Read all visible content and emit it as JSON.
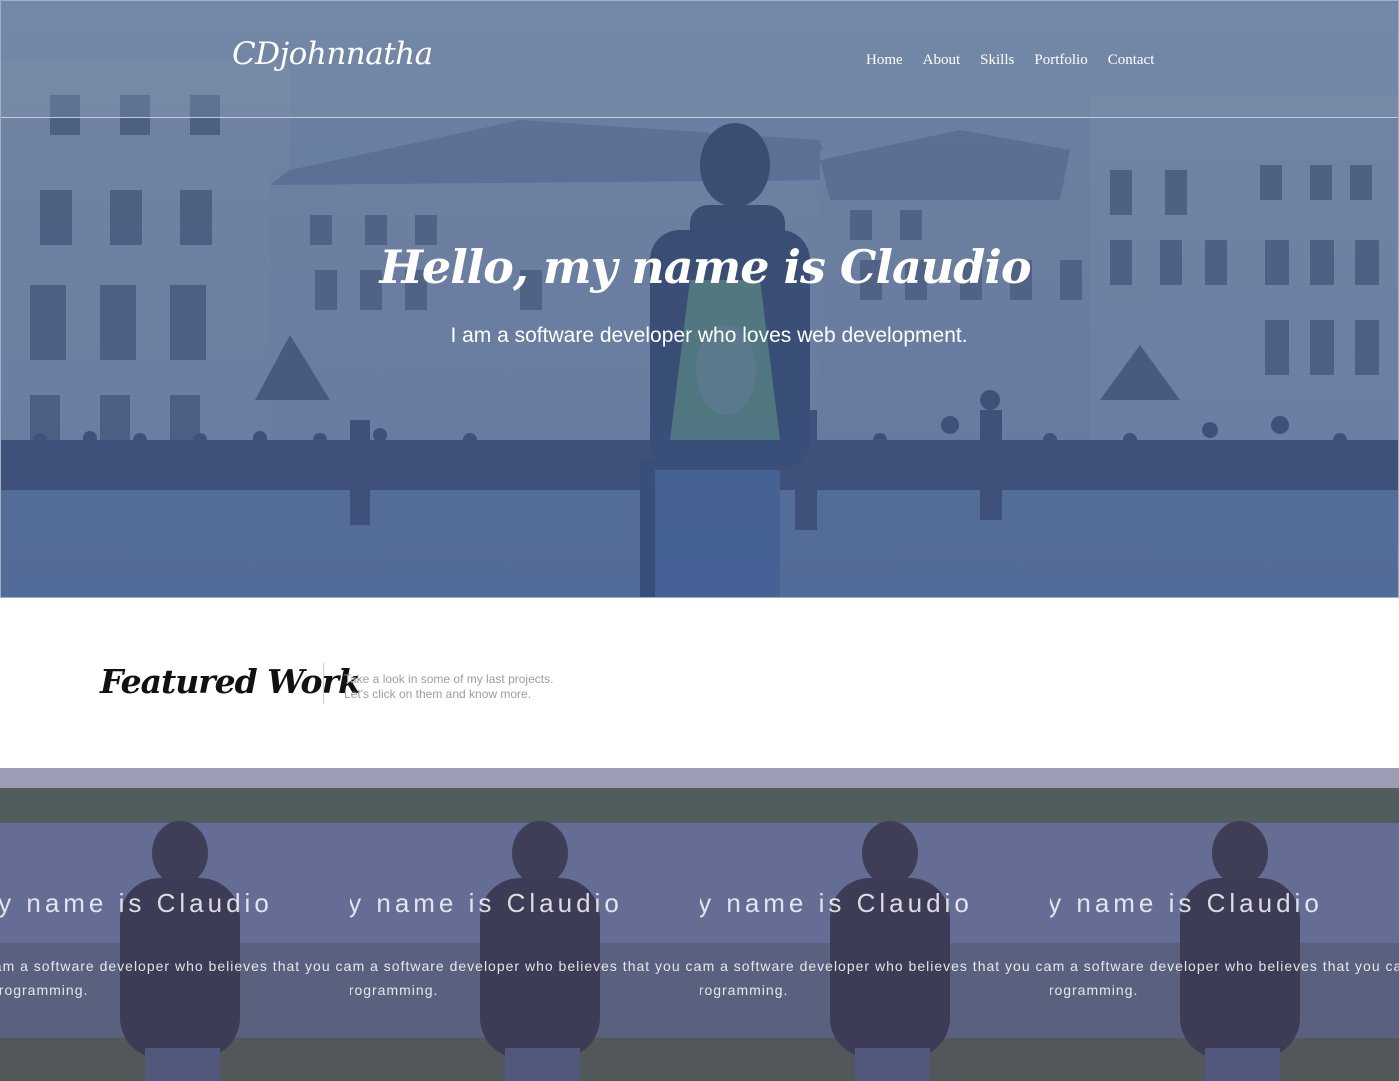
{
  "header": {
    "brand": "CDjohnnatha",
    "nav": [
      "Home",
      "About",
      "Skills",
      "Portfolio",
      "Contact"
    ]
  },
  "hero": {
    "title": "Hello, my name is Claudio",
    "subtitle": "I am a software developer who loves web development."
  },
  "featured": {
    "title": "Featured Work",
    "desc_line1": "Take a look in some of my last projects.",
    "desc_line2": "Let's click on them and know more."
  },
  "portfolio": {
    "items": [
      {
        "title": "Hello my name is Claudio",
        "desc_line1": "I am a software developer who believes that you can",
        "desc_line2": "programming."
      },
      {
        "title": "Hello my name is Claudio",
        "desc_line1": "I am a software developer who believes that you can",
        "desc_line2": "programming."
      },
      {
        "title": "Hello my name is Claudio",
        "desc_line1": "I am a software developer who believes that you can",
        "desc_line2": "programming."
      },
      {
        "title": "Hello my name is Claudio",
        "desc_line1": "I am a software developer who believes that you can",
        "desc_line2": "programming."
      }
    ]
  },
  "colors": {
    "hero_overlay": "#5d7198",
    "card_tint": "#5a5582",
    "text_dark": "#111111",
    "text_muted": "#9d9d9d"
  }
}
